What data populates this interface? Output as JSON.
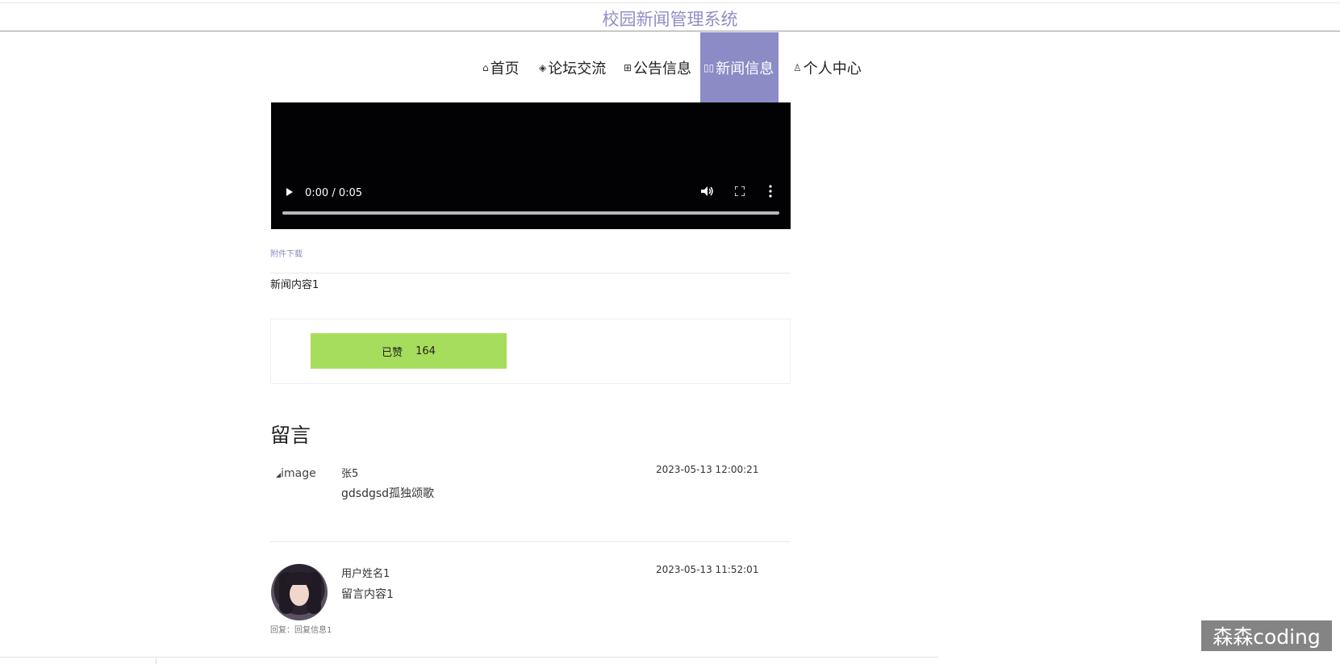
{
  "header": {
    "title": "校园新闻管理系统"
  },
  "nav": {
    "items": [
      {
        "label": "首页",
        "icon": "home-icon",
        "glyph": "⌂"
      },
      {
        "label": "论坛交流",
        "icon": "layers-icon",
        "glyph": "◈"
      },
      {
        "label": "公告信息",
        "icon": "gift-icon",
        "glyph": "⊞"
      },
      {
        "label": "新闻信息",
        "icon": "book-icon",
        "glyph": "▯▯"
      },
      {
        "label": "个人中心",
        "icon": "user-icon",
        "glyph": "♙"
      }
    ],
    "active_index": 3
  },
  "video": {
    "time": "0:00 / 0:05"
  },
  "article": {
    "attachment_label": "附件下载",
    "content": "新闻内容1"
  },
  "like": {
    "label": "已赞",
    "count": "164"
  },
  "comments": {
    "title": "留言",
    "items": [
      {
        "avatar_alt": "image",
        "name": "张5",
        "text": "gdsdgsd孤独颂歌",
        "time": "2023-05-13 12:00:21"
      },
      {
        "name": "用户姓名1",
        "text": "留言内容1",
        "time": "2023-05-13 11:52:01",
        "reply": "回复：回复信息1"
      }
    ]
  },
  "watermark": "森森coding"
}
